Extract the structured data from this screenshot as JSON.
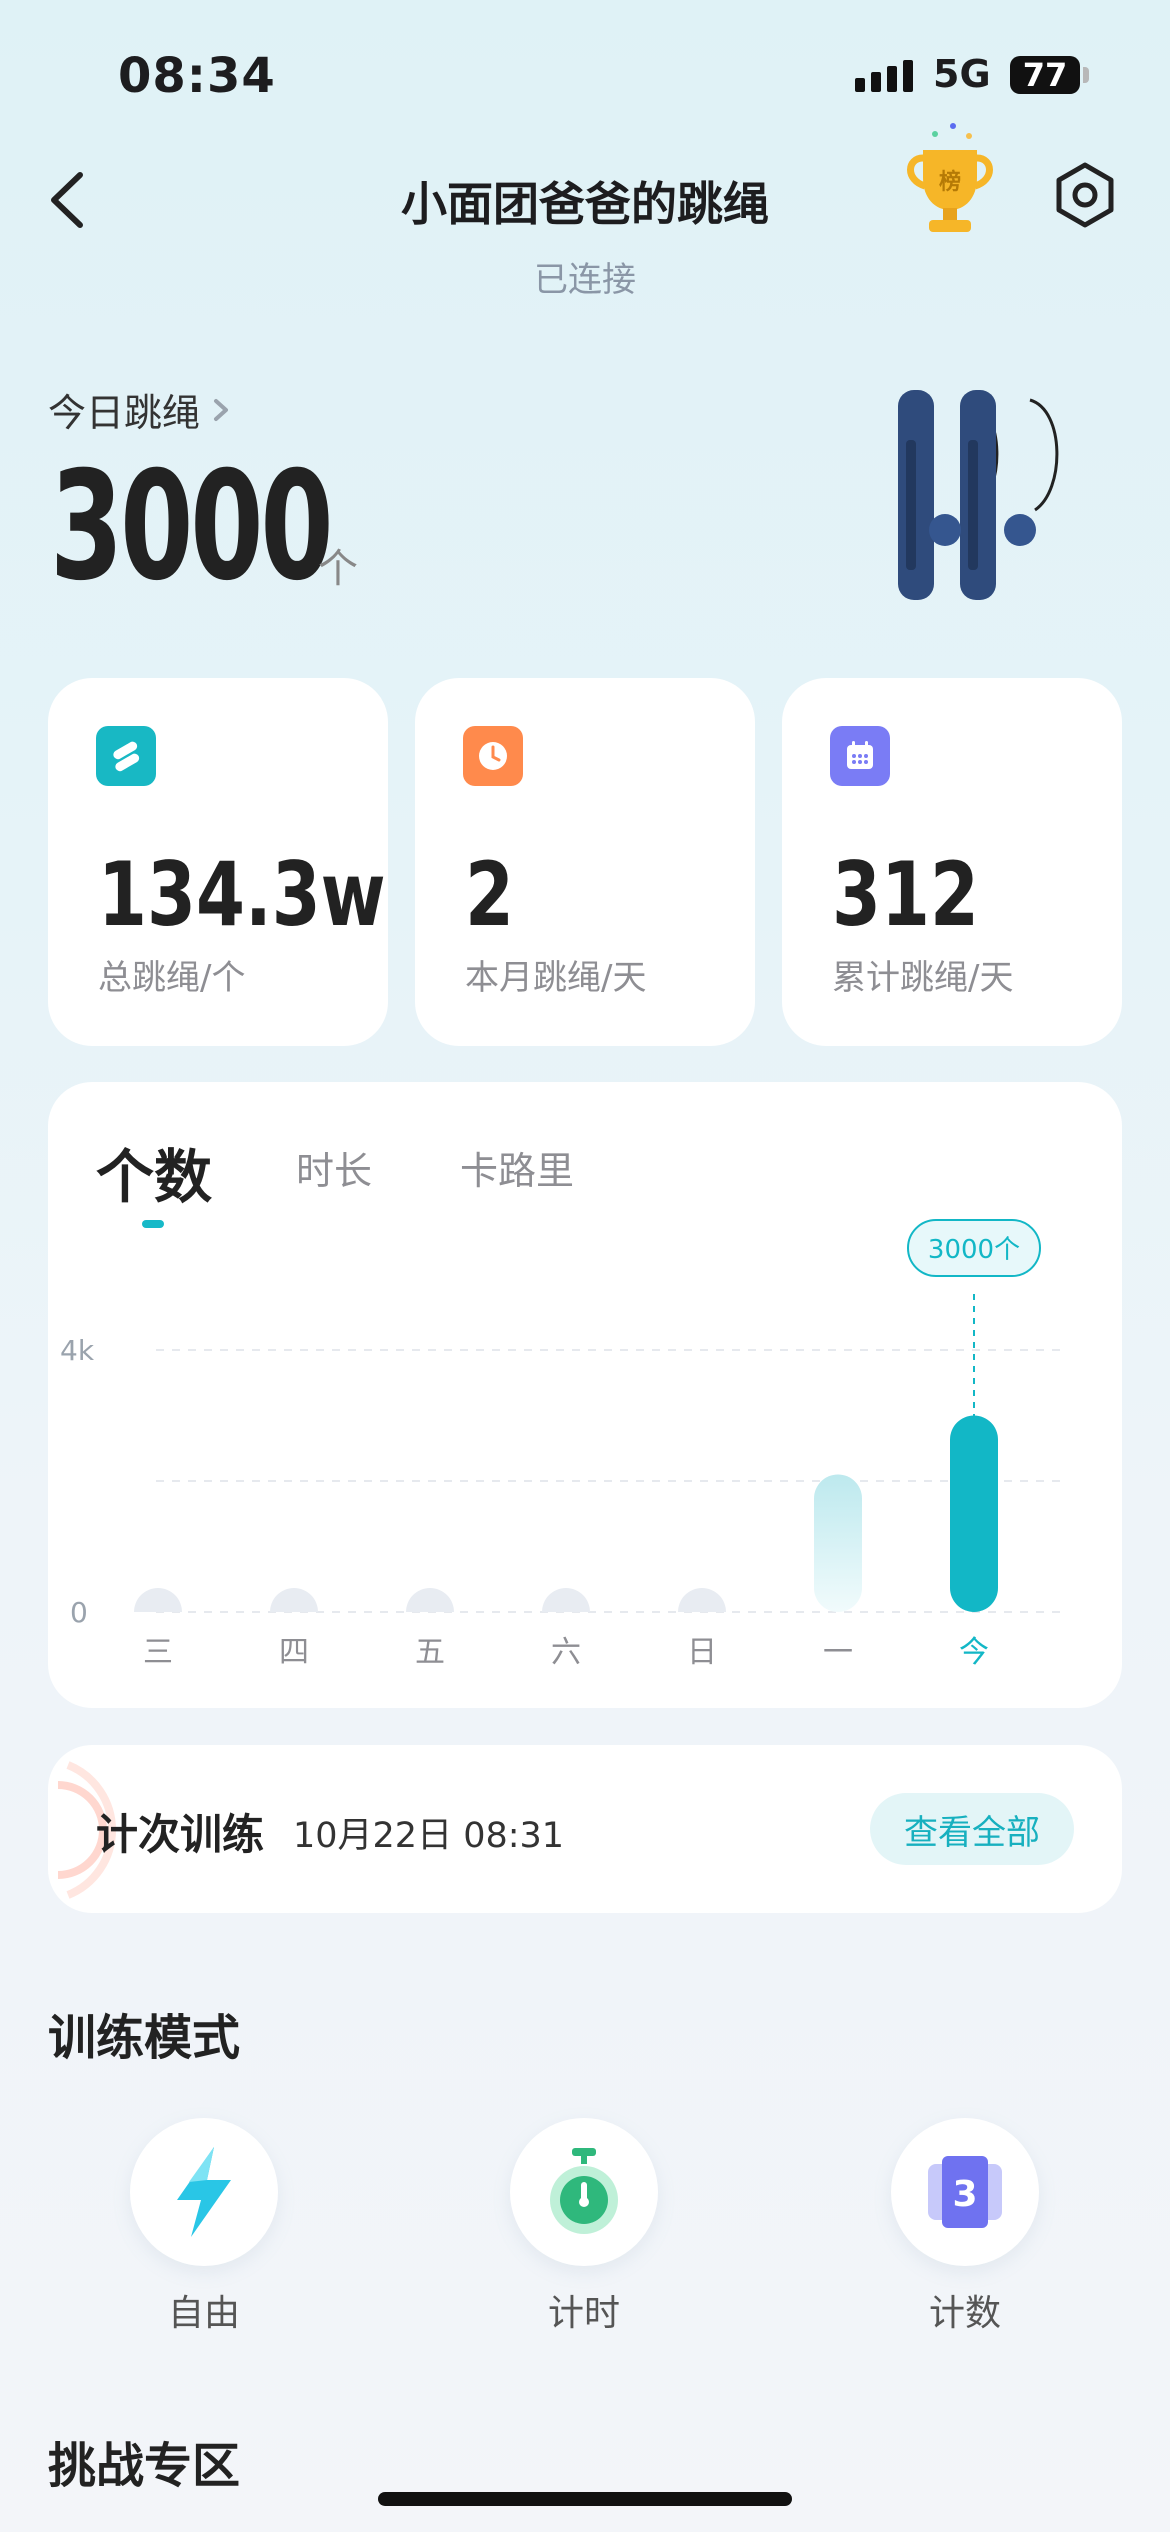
{
  "status_bar": {
    "time": "08:34",
    "network": "5G",
    "battery": "77"
  },
  "header": {
    "title": "小面团爸爸的跳绳",
    "subtitle": "已连接",
    "trophy_char": "榜"
  },
  "today": {
    "label": "今日跳绳",
    "value": "3000",
    "unit": "个"
  },
  "stats": [
    {
      "value": "134.3w",
      "label": "总跳绳/个",
      "icon": "rope-icon",
      "color": "#18b8c4"
    },
    {
      "value": "2",
      "label": "本月跳绳/天",
      "icon": "clock-icon",
      "color": "#ff8a4c"
    },
    {
      "value": "312",
      "label": "累计跳绳/天",
      "icon": "calendar-icon",
      "color": "#7a7cf5"
    }
  ],
  "chart_tabs": [
    "个数",
    "时长",
    "卡路里"
  ],
  "chart_data": {
    "type": "bar",
    "categories": [
      "三",
      "四",
      "五",
      "六",
      "日",
      "一",
      "今"
    ],
    "values": [
      0,
      0,
      0,
      0,
      0,
      2100,
      3000
    ],
    "ylim": [
      0,
      4000
    ],
    "yticks": [
      "0",
      "4k"
    ],
    "highlight_label": "3000个",
    "grid": true,
    "colors": {
      "active": "#12b7c6",
      "inactive_gradient_top": "#bde9ee",
      "empty": "#e8ecf2"
    }
  },
  "record": {
    "title": "计次训练",
    "time": "10月22日 08:31",
    "button": "查看全部"
  },
  "modes_section": {
    "title": "训练模式",
    "items": [
      {
        "label": "自由",
        "icon": "lightning-icon"
      },
      {
        "label": "计时",
        "icon": "stopwatch-icon"
      },
      {
        "label": "计数",
        "icon": "counter-icon",
        "glyph": "3"
      }
    ]
  },
  "challenge_section": {
    "title": "挑战专区"
  }
}
